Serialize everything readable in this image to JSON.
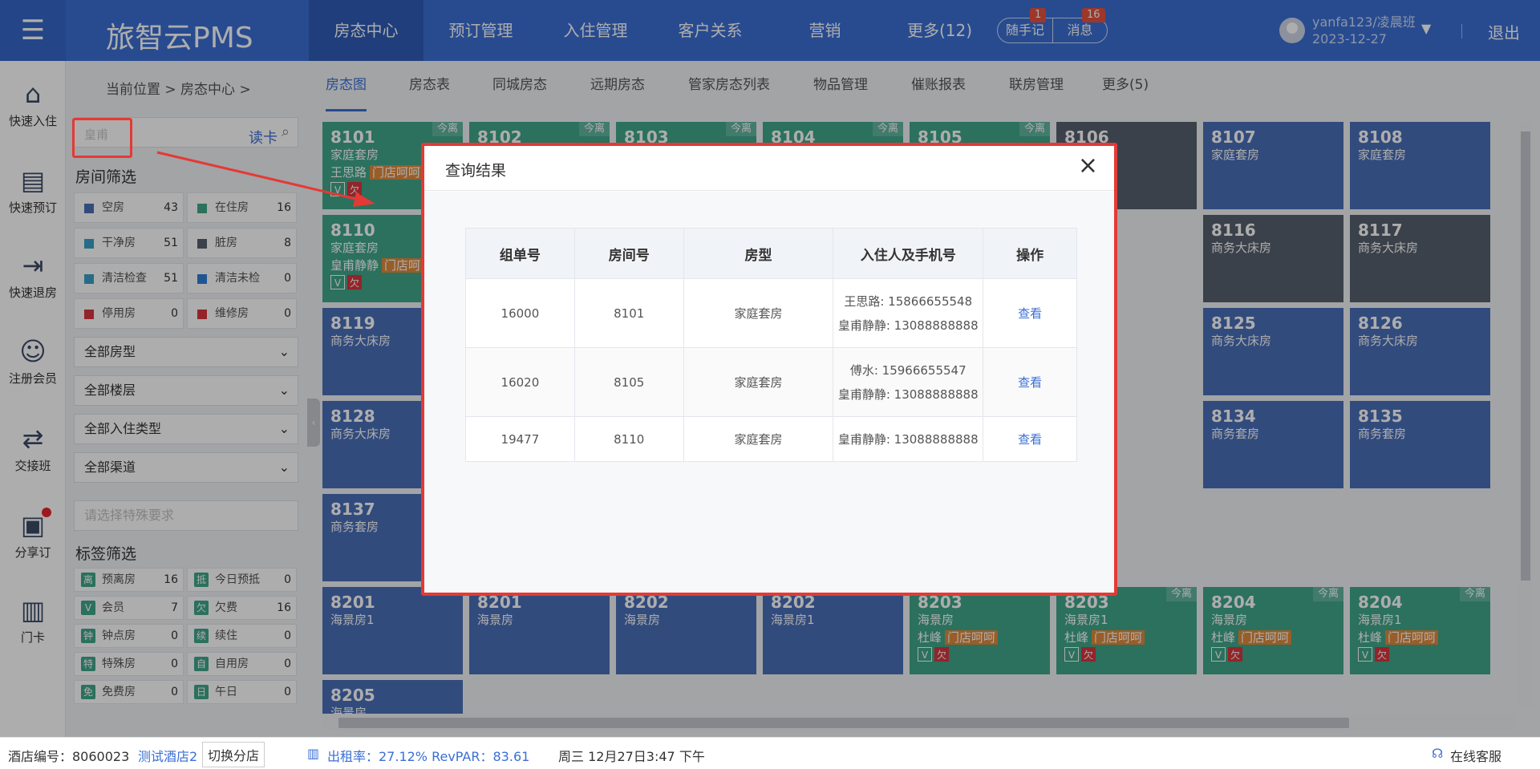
{
  "header": {
    "brand": "旅智云PMS",
    "nav": [
      "房态中心",
      "预订管理",
      "入住管理",
      "客户关系",
      "营销",
      "更多(12)"
    ],
    "notes_label": "随手记",
    "notes_badge": "1",
    "messages_label": "消息",
    "messages_badge": "16",
    "user_name": "yanfa123/凌晨班",
    "user_date": "2023-12-27",
    "logout": "退出"
  },
  "leftnav": [
    {
      "label": "快速入住",
      "icon": "home-icon"
    },
    {
      "label": "快速预订",
      "icon": "booking-icon"
    },
    {
      "label": "快速退房",
      "icon": "checkout-icon"
    },
    {
      "label": "注册会员",
      "icon": "add-member-icon"
    },
    {
      "label": "交接班",
      "icon": "shift-icon"
    },
    {
      "label": "分享订",
      "icon": "share-icon"
    },
    {
      "label": "门卡",
      "icon": "card-icon"
    }
  ],
  "breadcrumb": "当前位置 > 房态中心 >",
  "tabs": [
    "房态图",
    "房态表",
    "同城房态",
    "远期房态",
    "管家房态列表",
    "物品管理",
    "催账报表",
    "联房管理",
    "更多(5)"
  ],
  "search": {
    "value": "皇甫",
    "read_card": "读卡"
  },
  "room_filter": {
    "title": "房间筛选",
    "rows": [
      [
        {
          "label": "空房",
          "count": "43",
          "color": "#4a6fb8"
        },
        {
          "label": "在住房",
          "count": "16",
          "color": "#40a78a"
        }
      ],
      [
        {
          "label": "干净房",
          "count": "51",
          "color": "#3aa0c8"
        },
        {
          "label": "脏房",
          "count": "8",
          "color": "#58606d"
        }
      ],
      [
        {
          "label": "清洁检查",
          "count": "51",
          "color": "#3aa0c8"
        },
        {
          "label": "清洁未检",
          "count": "0",
          "color": "#2f7fd8"
        }
      ],
      [
        {
          "label": "停用房",
          "count": "0",
          "color": "#d9363e"
        },
        {
          "label": "维修房",
          "count": "0",
          "color": "#d9363e"
        }
      ]
    ]
  },
  "selects": [
    "全部房型",
    "全部楼层",
    "全部入住类型",
    "全部渠道"
  ],
  "special_placeholder": "请选择特殊要求",
  "tag_filter": {
    "title": "标签筛选",
    "rows": [
      [
        {
          "tag": "离",
          "label": "预离房",
          "count": "16",
          "color": "#40a78a"
        },
        {
          "tag": "抵",
          "label": "今日预抵",
          "count": "0",
          "color": "#40a78a"
        }
      ],
      [
        {
          "tag": "V",
          "label": "会员",
          "count": "7",
          "color": "#40a78a"
        },
        {
          "tag": "欠",
          "label": "欠费",
          "count": "16",
          "color": "#40a78a"
        }
      ],
      [
        {
          "tag": "钟",
          "label": "钟点房",
          "count": "0",
          "color": "#40a78a"
        },
        {
          "tag": "续",
          "label": "续住",
          "count": "0",
          "color": "#40a78a"
        }
      ],
      [
        {
          "tag": "特",
          "label": "特殊房",
          "count": "0",
          "color": "#40a78a"
        },
        {
          "tag": "自",
          "label": "自用房",
          "count": "0",
          "color": "#40a78a"
        }
      ],
      [
        {
          "tag": "免",
          "label": "免费房",
          "count": "0",
          "color": "#40a78a"
        },
        {
          "tag": "日",
          "label": "午日",
          "count": "0",
          "color": "#40a78a"
        }
      ]
    ]
  },
  "rooms": [
    {
      "rn": "8101",
      "type": "家庭套房",
      "guest": "王思路",
      "hot": "门店呵呵",
      "status": "occ",
      "corner": "今离"
    },
    {
      "rn": "8102",
      "type": "",
      "status": "occ",
      "corner": "今离"
    },
    {
      "rn": "8103",
      "type": "",
      "status": "occ",
      "corner": "今离"
    },
    {
      "rn": "8104",
      "type": "",
      "status": "occ",
      "corner": "今离"
    },
    {
      "rn": "8105",
      "type": "",
      "status": "occ",
      "corner": "今离"
    },
    {
      "rn": "8106",
      "type": "",
      "status": "dirty"
    },
    {
      "rn": "8107",
      "type": "家庭套房",
      "status": "empty"
    },
    {
      "rn": "8108",
      "type": "家庭套房",
      "status": "empty"
    },
    {
      "rn": "8110",
      "type": "家庭套房",
      "guest": "皇甫静静",
      "hot": "门店呵",
      "status": "occ"
    },
    {
      "rn": "8116",
      "type": "商务大床房",
      "status": "dirty"
    },
    {
      "rn": "8117",
      "type": "商务大床房",
      "status": "dirty"
    },
    {
      "rn": "8119",
      "type": "商务大床房",
      "status": "empty"
    },
    {
      "rn": "8125",
      "type": "商务大床房",
      "status": "empty"
    },
    {
      "rn": "8126",
      "type": "商务大床房",
      "status": "empty"
    },
    {
      "rn": "8128",
      "type": "商务大床房",
      "status": "empty"
    },
    {
      "rn": "8134",
      "type": "商务套房",
      "status": "empty"
    },
    {
      "rn": "8135",
      "type": "商务套房",
      "status": "empty"
    },
    {
      "rn": "8137",
      "type": "商务套房",
      "status": "empty"
    },
    {
      "rn": "8201",
      "type": "海景房1",
      "status": "empty"
    },
    {
      "rn": "8201",
      "type": "海景房",
      "status": "empty"
    },
    {
      "rn": "8202",
      "type": "海景房",
      "status": "empty"
    },
    {
      "rn": "8202",
      "type": "海景房1",
      "status": "empty"
    },
    {
      "rn": "8203",
      "type": "海景房",
      "guest": "杜峰",
      "hot": "门店呵呵",
      "status": "occ"
    },
    {
      "rn": "8203",
      "type": "海景房1",
      "guest": "杜峰",
      "hot": "门店呵呵",
      "status": "occ",
      "corner": "今离"
    },
    {
      "rn": "8204",
      "type": "海景房",
      "guest": "杜峰",
      "hot": "门店呵呵",
      "status": "occ",
      "corner": "今离"
    },
    {
      "rn": "8204",
      "type": "海景房1",
      "guest": "杜峰",
      "hot": "门店呵呵",
      "status": "occ",
      "corner": "今离"
    },
    {
      "rn": "8205",
      "type": "海景房",
      "status": "empty"
    }
  ],
  "modal": {
    "title": "查询结果",
    "headers": [
      "组单号",
      "房间号",
      "房型",
      "入住人及手机号",
      "操作"
    ],
    "rows": [
      {
        "group": "16000",
        "room": "8101",
        "type": "家庭套房",
        "guests": [
          "王思路: 15866655548",
          "皇甫静静: 13088888888"
        ],
        "action": "查看"
      },
      {
        "group": "16020",
        "room": "8105",
        "type": "家庭套房",
        "guests": [
          "傅水: 15966655547",
          "皇甫静静: 13088888888"
        ],
        "action": "查看"
      },
      {
        "group": "19477",
        "room": "8110",
        "type": "家庭套房",
        "guests": [
          "皇甫静静: 13088888888"
        ],
        "action": "查看"
      }
    ]
  },
  "status": {
    "hotel_no": "酒店编号：8060023",
    "hotel_name": "测试酒店2",
    "switch": "切换分店",
    "occupancy": "出租率：27.12% RevPAR：83.61",
    "datetime": "周三 12月27日3:47 下午",
    "service": "在线客服"
  }
}
